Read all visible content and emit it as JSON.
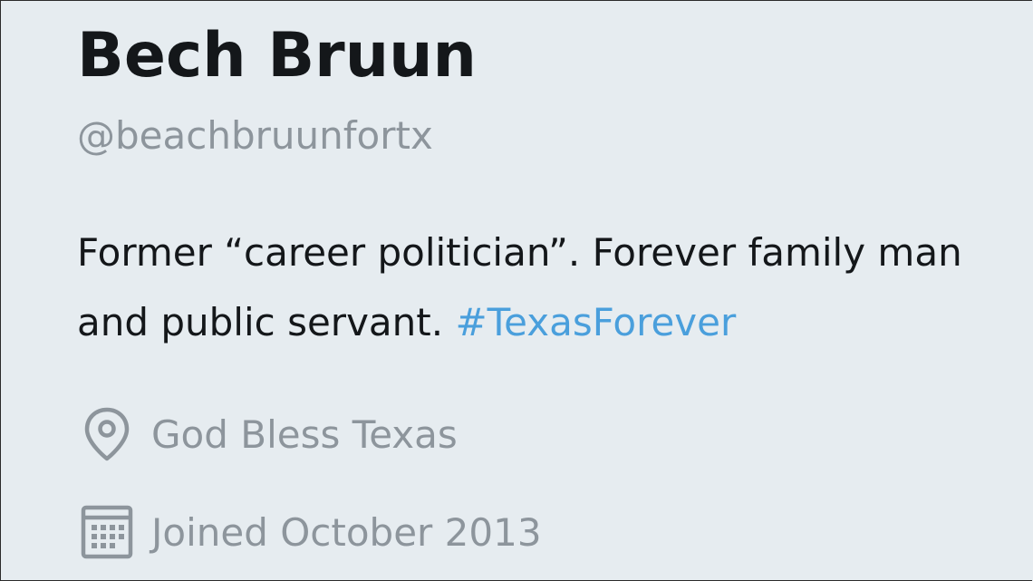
{
  "profile": {
    "display_name": "Bech Bruun",
    "handle": "@beachbruunfortx",
    "bio": {
      "text_before": "Former “career politician”. Forever family man and public servant. ",
      "hashtag": "#TexasForever"
    },
    "location": {
      "icon": "location-pin-icon",
      "text": "God Bless Texas"
    },
    "joined": {
      "icon": "calendar-icon",
      "text": "Joined October 2013"
    }
  },
  "colors": {
    "background": "#e6ecf0",
    "name_text": "#14171a",
    "secondary_text": "#8d959c",
    "hashtag": "#4a9fdc"
  }
}
